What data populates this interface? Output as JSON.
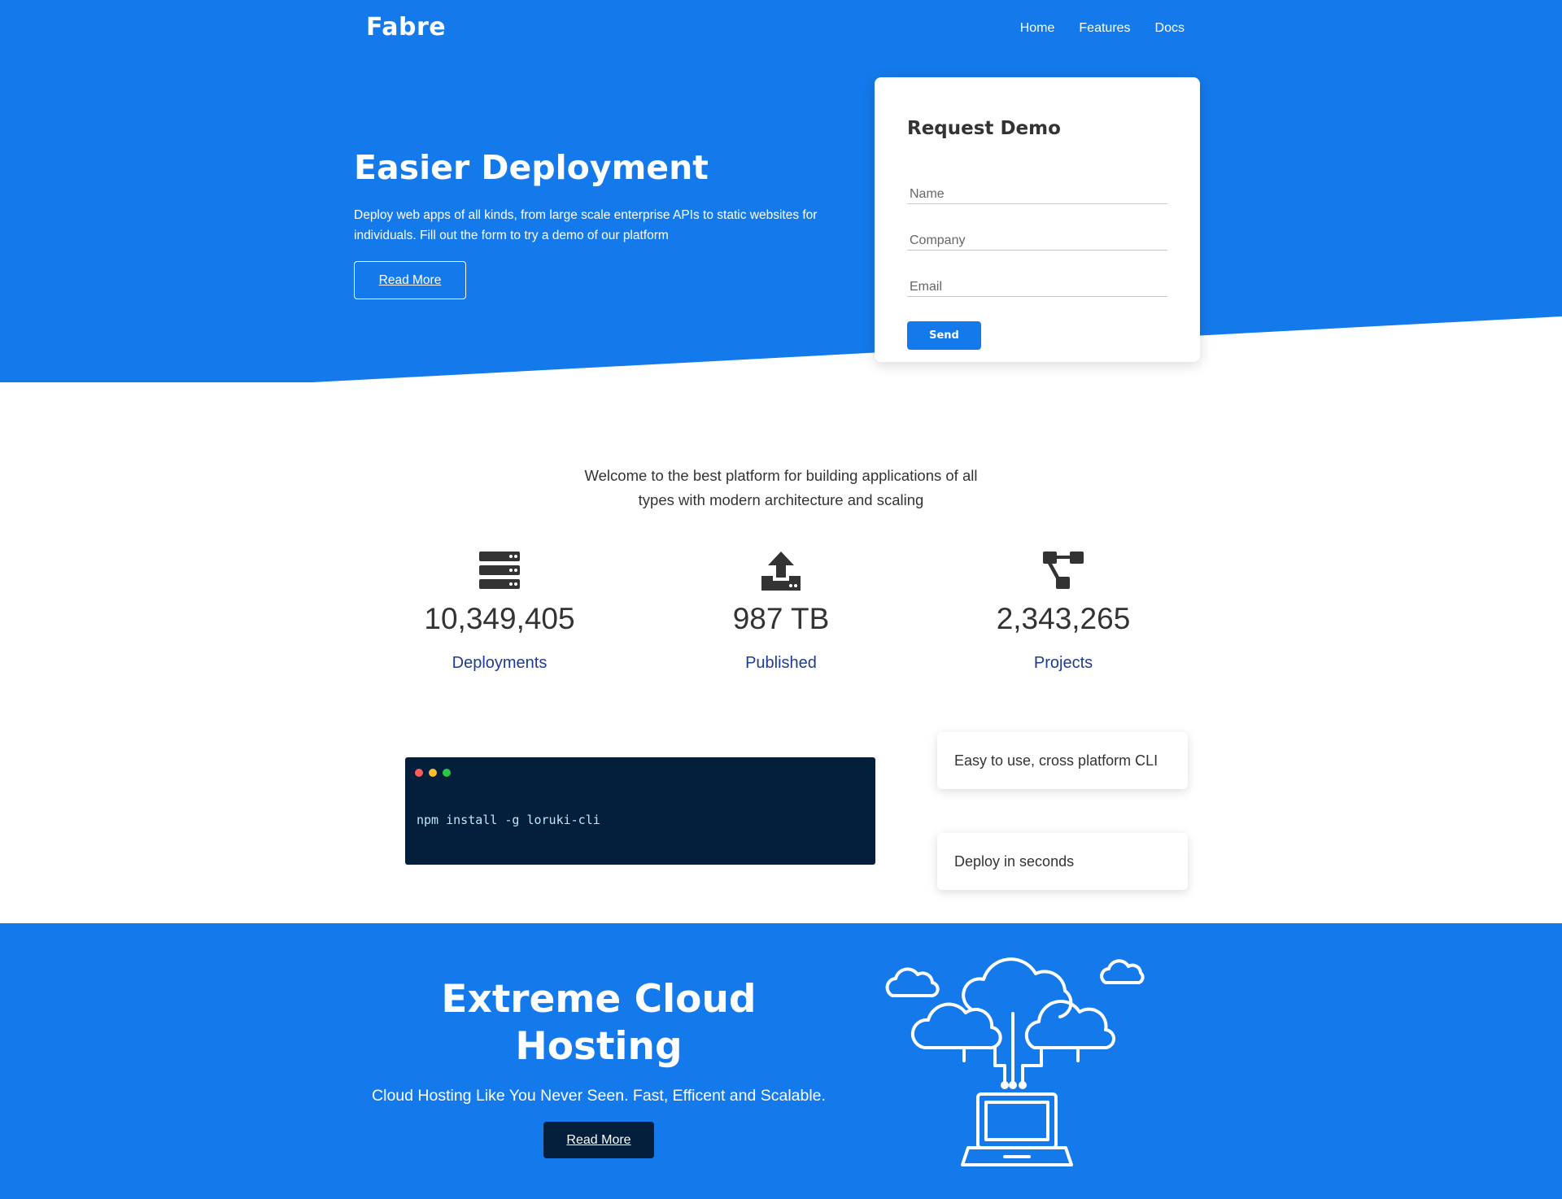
{
  "header": {
    "brand": "Fabre",
    "nav": [
      {
        "label": "Home"
      },
      {
        "label": "Features"
      },
      {
        "label": "Docs"
      }
    ]
  },
  "hero": {
    "title": "Easier Deployment",
    "description": "Deploy web apps of all kinds, from large scale enterprise APIs to static websites for individuals. Fill out the form to try a demo of our platform",
    "read_more_label": "Read More"
  },
  "demo_form": {
    "title": "Request Demo",
    "fields": {
      "name_placeholder": "Name",
      "company_placeholder": "Company",
      "email_placeholder": "Email"
    },
    "send_label": "Send"
  },
  "welcome": {
    "text": "Welcome to the best platform for building applications of all types with modern architecture and scaling"
  },
  "stats": [
    {
      "icon": "server-icon",
      "value": "10,349,405",
      "label": "Deployments"
    },
    {
      "icon": "upload-icon",
      "value": "987 TB",
      "label": "Published"
    },
    {
      "icon": "project-diagram-icon",
      "value": "2,343,265",
      "label": "Projects"
    }
  ],
  "terminal": {
    "command": "npm install -g loruki-cli",
    "dot_colors": [
      "#fc5e57",
      "#fdbb2e",
      "#28c840"
    ]
  },
  "features": [
    {
      "label": "Easy to use, cross platform CLI"
    },
    {
      "label": "Deploy in seconds"
    }
  ],
  "cloud": {
    "title": "Extreme Cloud Hosting",
    "subtitle": "Cloud Hosting Like You Never Seen. Fast, Efficent and Scalable.",
    "read_more_label": "Read More",
    "illustration_icon": "cloud-network-laptop-icon"
  },
  "colors": {
    "primary": "#1479ea",
    "dark": "#031f3c",
    "stat_label": "#1f3a93"
  }
}
